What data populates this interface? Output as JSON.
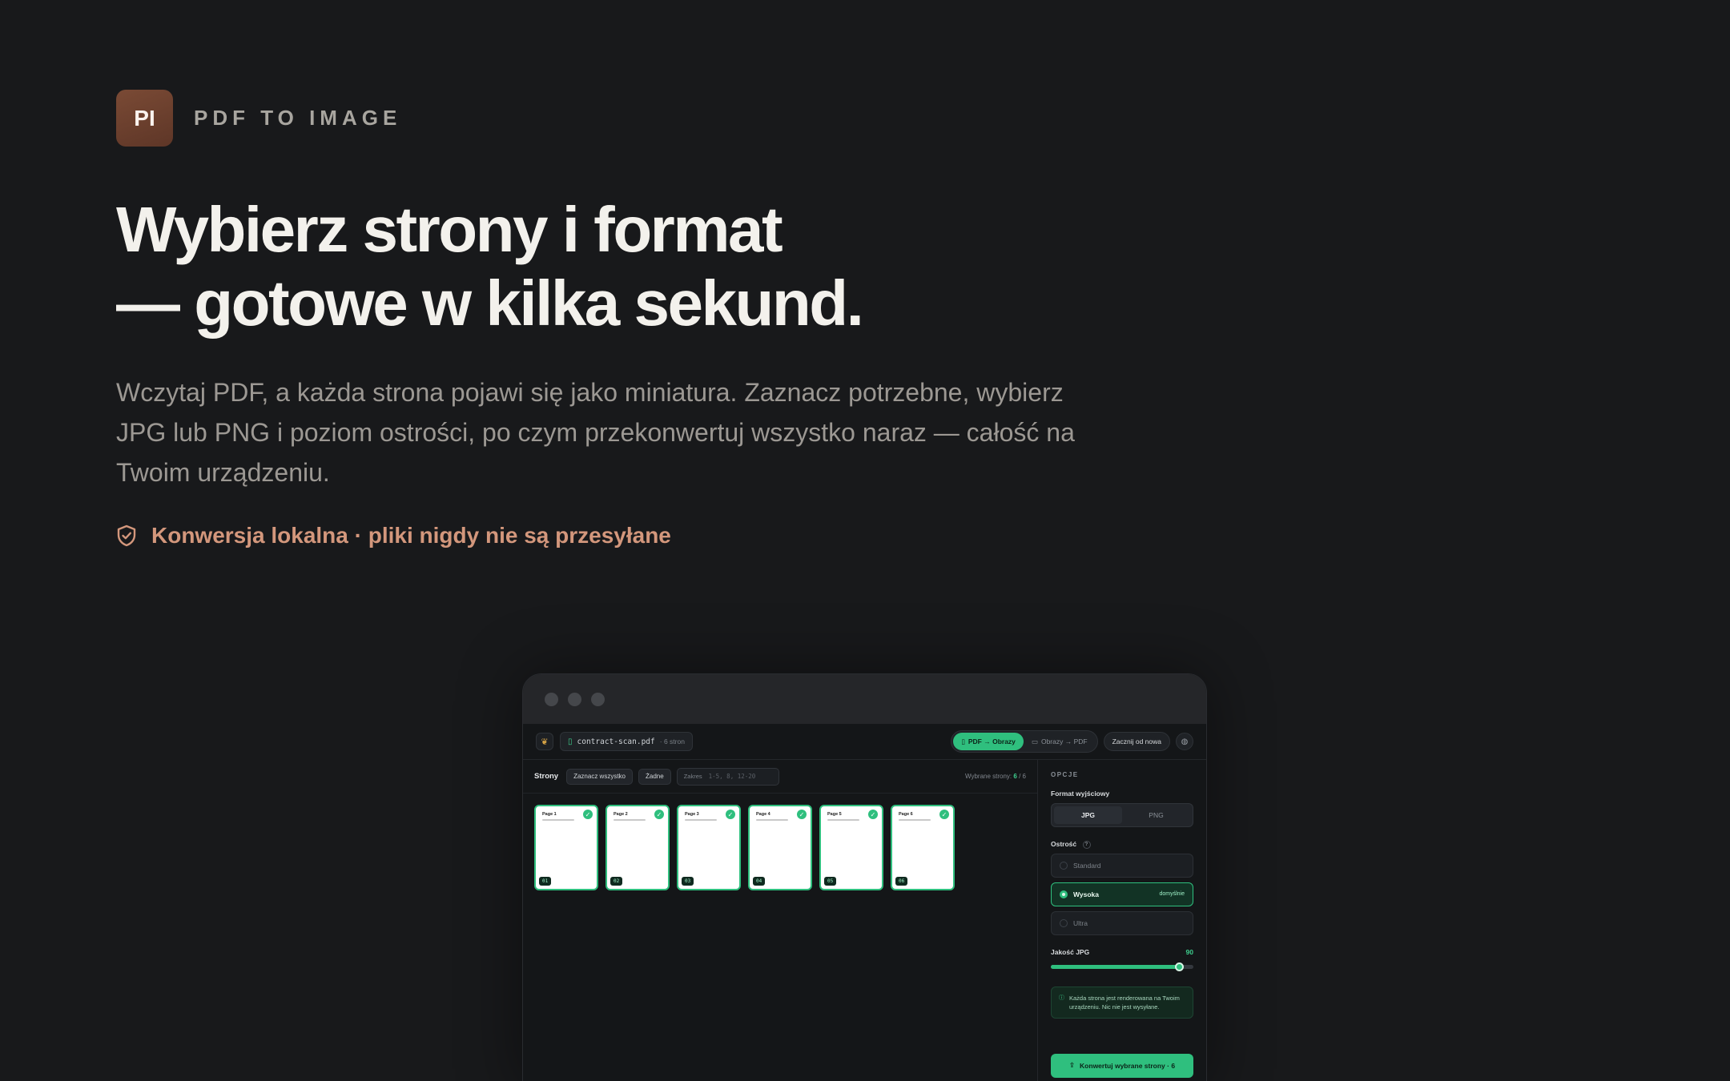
{
  "brand": {
    "logo_text": "PI",
    "name": "PDF TO IMAGE"
  },
  "headline": {
    "line1": "Wybierz strony i format",
    "line2": "— gotowe w kilka sekund."
  },
  "lead": "Wczytaj PDF, a każda strona pojawi się jako miniatura. Zaznacz potrzebne, wybierz JPG lub PNG i poziom ostrości, po czym przekonwertuj wszystko naraz — całość na Twoim urządzeniu.",
  "badge": {
    "icon": "shield-check-icon",
    "text": "Konwersja lokalna · pliki nigdy nie są przesyłane"
  },
  "app": {
    "file": {
      "name": "contract-scan.pdf",
      "meta": "· 6 stron"
    },
    "modes": [
      {
        "label": "PDF → Obrazy",
        "icon": "file-icon",
        "active": true
      },
      {
        "label": "Obrazy → PDF",
        "icon": "image-icon",
        "active": false
      }
    ],
    "restart_label": "Zacznij od nowa",
    "toolbar": {
      "title": "Strony",
      "select_all": "Zaznacz wszystko",
      "select_none": "Żadne",
      "range_label": "Zakres",
      "range_placeholder": "1-5, 8, 12-20",
      "selected_label": "Wybrane strony:",
      "selected_count": "6",
      "separator": "/",
      "total_count": "6"
    },
    "pages": [
      {
        "title": "Page 1",
        "num": "01"
      },
      {
        "title": "Page 2",
        "num": "02"
      },
      {
        "title": "Page 3",
        "num": "03"
      },
      {
        "title": "Page 4",
        "num": "04"
      },
      {
        "title": "Page 5",
        "num": "05"
      },
      {
        "title": "Page 6",
        "num": "06"
      }
    ],
    "options": {
      "heading": "OPCJE",
      "format_label": "Format wyjściowy",
      "formats": [
        {
          "label": "JPG",
          "active": true
        },
        {
          "label": "PNG",
          "active": false
        }
      ],
      "sharpness_label": "Ostrość",
      "sharpness_help": "?",
      "sharpness_levels": [
        {
          "label": "Standard",
          "active": false,
          "tag": ""
        },
        {
          "label": "Wysoka",
          "active": true,
          "tag": "domyślnie"
        },
        {
          "label": "Ultra",
          "active": false,
          "tag": ""
        }
      ],
      "quality_label": "Jakość JPG",
      "quality_value": "90",
      "quality_fraction": 0.9,
      "info": "Każda strona jest renderowana na Twoim urządzeniu. Nic nie jest wysyłane.",
      "convert_label": "Konwertuj wybrane strony · 6"
    }
  },
  "colors": {
    "accent": "#2fbf7e",
    "brand": "#6e4130",
    "badge": "#d3977c",
    "background": "#18191b"
  }
}
